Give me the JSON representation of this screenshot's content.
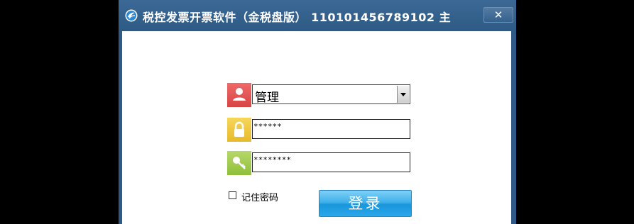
{
  "window": {
    "title": "税控发票开票软件（金税盘版） 110101456789102 主",
    "close_label": "✕"
  },
  "login": {
    "user_value": "管理",
    "password_mask": "******",
    "cert_password_mask": "********",
    "remember_label": "记住密码",
    "remember_checked": false,
    "submit_label": "登录"
  },
  "icons": {
    "app": "app-logo-icon",
    "user": "user-icon",
    "password": "lock-icon",
    "cert": "key-icon"
  },
  "colors": {
    "titlebar": "#2f5a87",
    "user_icon_bg": "#e25555",
    "password_icon_bg": "#efc840",
    "cert_icon_bg": "#a3cc52",
    "login_button": "#2aa8ea"
  }
}
